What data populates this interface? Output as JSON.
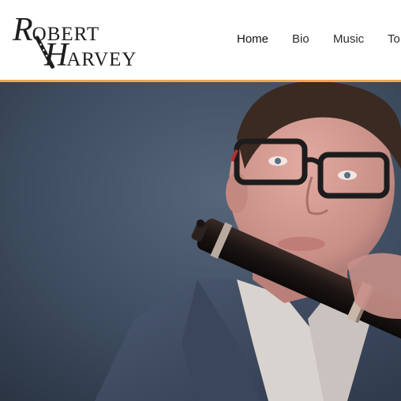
{
  "site": {
    "logo_first_cap": "R",
    "logo_first_rest": "OBERT",
    "logo_last_cap": "H",
    "logo_last_rest": "ARVEY"
  },
  "nav": {
    "items": [
      {
        "label": "Home",
        "active": true
      },
      {
        "label": "Bio",
        "active": false
      },
      {
        "label": "Music",
        "active": false
      },
      {
        "label": "To",
        "active": false
      }
    ]
  },
  "colors": {
    "accent": "#f3a64a",
    "header_bg": "#ffffff",
    "hero_bg": "#3c4a5e"
  }
}
